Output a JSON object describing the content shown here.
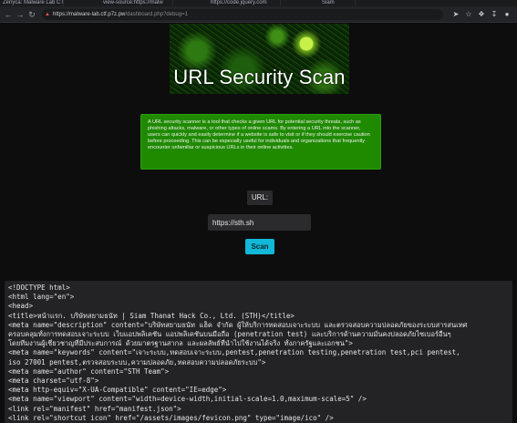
{
  "browser": {
    "tabs": [
      "Zenyca: Malware Lab CTF",
      "view-source:https://malw",
      "https://code.jquery.com",
      "Siam",
      "x"
    ],
    "url_warning": "Not secure",
    "url_host": "https://malware-lab.ctf.p7z.pw",
    "url_path": "/dashboard.php?debug=1",
    "ext_icons": [
      "send-icon",
      "star-icon",
      "puzzle-icon",
      "download-icon",
      "profile-icon",
      "menu-icon"
    ]
  },
  "page": {
    "banner_title": "URL Security Scan",
    "description": "A URL security scanner is a tool that checks a given URL for potential security threats, such as phishing attacks, malware, or other types of online scams. By entering a URL into the scanner, users can quickly and easily determine if a website is safe to visit or if they should exercise caution before proceeding. This can be especially useful for individuals and organizations that frequently encounter unfamiliar or suspicious URLs in their online activities.",
    "url_label": "URL:",
    "url_value": "https://sth.sh",
    "scan_label": "Scan"
  },
  "source_lines": [
    "<!DOCTYPE html>",
    "<html lang=\"en\">",
    "<head>",
    "<title>หน้าแรก. บริษัทสยามธนัท | Siam Thanat Hack Co., Ltd. (STH)</title>",
    "<meta name=\"description\" content=\"บริษัทสยามธนัท แฮ็ค จำกัด ผู้ให้บริการทดสอบเจาะระบบ และตรวจสอบความปลอดภัยของระบบสารสนเทศ",
    "ครอบคลุมทั้งการทดสอบเจาะระบบ เว็บแอปพลิเคชัน แอปพลิเคชันบนมือถือ (penetration test) และบริการด้านความมั่นคงปลอดภัยไซเบอร์อื่นๆ",
    "โดยทีมงานผู้เชี่ยวชาญที่มีประสบการณ์ ด้วยมาตรฐานสากล และผลลัพธ์ที่นำไปใช้งานได้จริง ทั้งภาครัฐและเอกชน\">",
    "<meta name=\"keywords\" content=\"เจาะระบบ,ทดสอบเจาะระบบ,pentest,penetration testing,penetration test,pci pentest,",
    "iso 27001 pentest,ตรวจสอบระบบ,ความปลอดภัย,ทดสอบความปลอดภัยระบบ\">",
    "<meta name=\"author\" content=\"STH Team\">",
    "<meta charset=\"utf-8\">",
    "<meta http-equiv=\"X-UA-Compatible\" content=\"IE=edge\">",
    "<meta name=\"viewport\" content=\"width=device-width,initial-scale=1.0,maximum-scale=5\" />",
    "<link rel=\"manifest\" href=\"manifest.json\">",
    "<link rel=\"shortcut icon\" href=\"/assets/images/fevicon.png\" type=\"image/ico\" />"
  ]
}
